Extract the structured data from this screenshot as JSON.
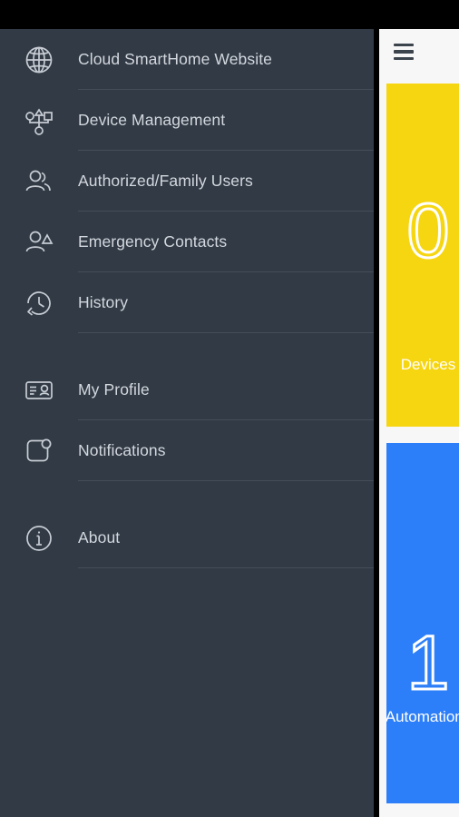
{
  "window": {
    "background_color": "#323a45",
    "status_bar_color": "#000000"
  },
  "drawer": {
    "background_color": "#323a45",
    "text_color": "#d3d8de",
    "divider_color": "#454d58",
    "groups": [
      {
        "items": [
          {
            "label": "Cloud SmartHome Website",
            "icon": "globe-icon"
          },
          {
            "label": "Device Management",
            "icon": "device-hub-icon"
          },
          {
            "label": "Authorized/Family Users",
            "icon": "users-group-icon"
          },
          {
            "label": "Emergency Contacts",
            "icon": "user-alert-icon"
          },
          {
            "label": "History",
            "icon": "history-clock-icon"
          }
        ]
      },
      {
        "items": [
          {
            "label": "My Profile",
            "icon": "id-card-icon"
          },
          {
            "label": "Notifications",
            "icon": "notification-badge-icon"
          }
        ]
      },
      {
        "items": [
          {
            "label": "About",
            "icon": "info-circle-icon"
          }
        ]
      }
    ]
  },
  "app": {
    "app_bar": {
      "menu_icon": "hamburger-menu-icon"
    },
    "cards": [
      {
        "name": "devices-card",
        "color": "#f6d511",
        "figure": "0",
        "label": "Devices"
      },
      {
        "name": "automations-card",
        "color": "#2d7ff9",
        "figure": "1",
        "label": "Automations"
      }
    ]
  }
}
